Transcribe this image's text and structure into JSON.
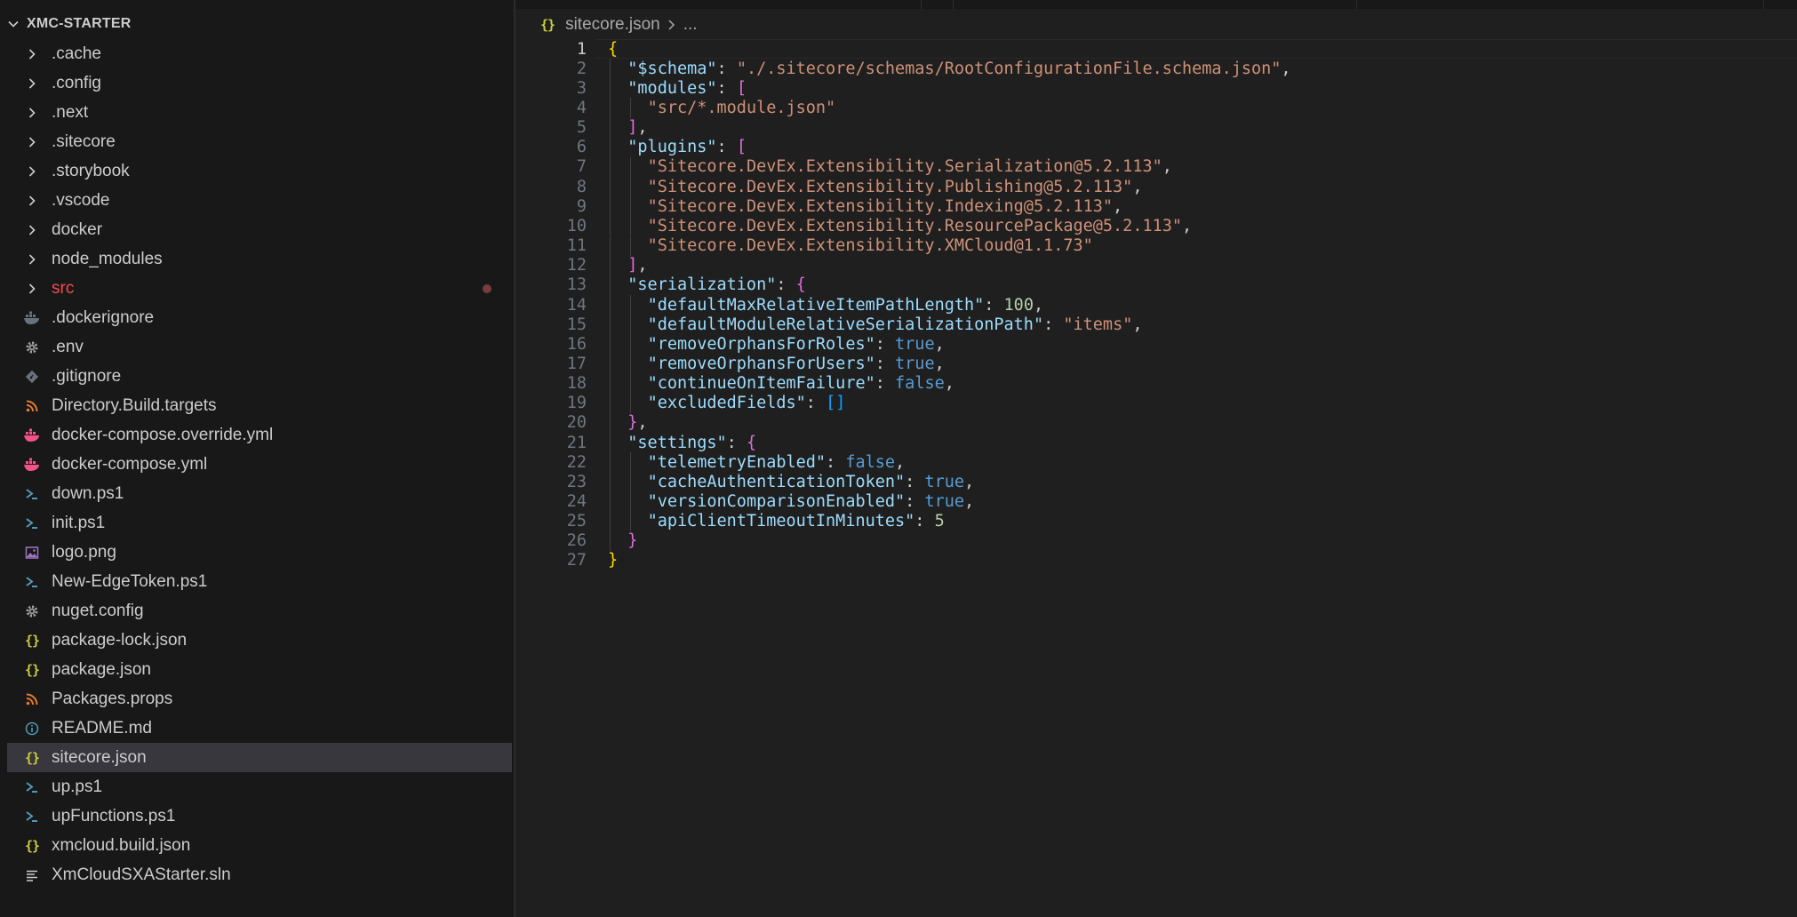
{
  "explorer": {
    "title": "XMC-STARTER",
    "items": [
      {
        "label": ".cache",
        "kind": "folder"
      },
      {
        "label": ".config",
        "kind": "folder"
      },
      {
        "label": ".next",
        "kind": "folder"
      },
      {
        "label": ".sitecore",
        "kind": "folder"
      },
      {
        "label": ".storybook",
        "kind": "folder"
      },
      {
        "label": ".vscode",
        "kind": "folder"
      },
      {
        "label": "docker",
        "kind": "folder"
      },
      {
        "label": "node_modules",
        "kind": "folder"
      },
      {
        "label": "src",
        "kind": "folder",
        "modified": true
      },
      {
        "label": ".dockerignore",
        "kind": "docker-ignore"
      },
      {
        "label": ".env",
        "kind": "gear"
      },
      {
        "label": ".gitignore",
        "kind": "git"
      },
      {
        "label": "Directory.Build.targets",
        "kind": "rss"
      },
      {
        "label": "docker-compose.override.yml",
        "kind": "docker"
      },
      {
        "label": "docker-compose.yml",
        "kind": "docker"
      },
      {
        "label": "down.ps1",
        "kind": "powershell"
      },
      {
        "label": "init.ps1",
        "kind": "powershell"
      },
      {
        "label": "logo.png",
        "kind": "image"
      },
      {
        "label": "New-EdgeToken.ps1",
        "kind": "powershell"
      },
      {
        "label": "nuget.config",
        "kind": "gear"
      },
      {
        "label": "package-lock.json",
        "kind": "json"
      },
      {
        "label": "package.json",
        "kind": "json"
      },
      {
        "label": "Packages.props",
        "kind": "rss"
      },
      {
        "label": "README.md",
        "kind": "info"
      },
      {
        "label": "sitecore.json",
        "kind": "json",
        "selected": true
      },
      {
        "label": "up.ps1",
        "kind": "powershell"
      },
      {
        "label": "upFunctions.ps1",
        "kind": "powershell"
      },
      {
        "label": "xmcloud.build.json",
        "kind": "json"
      },
      {
        "label": "XmCloudSXAStarter.sln",
        "kind": "lines"
      }
    ]
  },
  "breadcrumb": {
    "icon": "{}",
    "file": "sitecore.json",
    "rest": "..."
  },
  "editor": {
    "current_line": 1,
    "lines": [
      [
        [
          "b1",
          "{"
        ]
      ],
      [
        [
          "sp",
          "  "
        ],
        [
          "key",
          "\"$schema\""
        ],
        [
          "p",
          ": "
        ],
        [
          "str",
          "\"./.sitecore/schemas/RootConfigurationFile.schema.json\""
        ],
        [
          "p",
          ","
        ]
      ],
      [
        [
          "sp",
          "  "
        ],
        [
          "key",
          "\"modules\""
        ],
        [
          "p",
          ": "
        ],
        [
          "b2",
          "["
        ]
      ],
      [
        [
          "sp",
          "    "
        ],
        [
          "str",
          "\"src/*.module.json\""
        ]
      ],
      [
        [
          "sp",
          "  "
        ],
        [
          "b2",
          "]"
        ],
        [
          "p",
          ","
        ]
      ],
      [
        [
          "sp",
          "  "
        ],
        [
          "key",
          "\"plugins\""
        ],
        [
          "p",
          ": "
        ],
        [
          "b2",
          "["
        ]
      ],
      [
        [
          "sp",
          "    "
        ],
        [
          "str",
          "\"Sitecore.DevEx.Extensibility.Serialization@5.2.113\""
        ],
        [
          "p",
          ","
        ]
      ],
      [
        [
          "sp",
          "    "
        ],
        [
          "str",
          "\"Sitecore.DevEx.Extensibility.Publishing@5.2.113\""
        ],
        [
          "p",
          ","
        ]
      ],
      [
        [
          "sp",
          "    "
        ],
        [
          "str",
          "\"Sitecore.DevEx.Extensibility.Indexing@5.2.113\""
        ],
        [
          "p",
          ","
        ]
      ],
      [
        [
          "sp",
          "    "
        ],
        [
          "str",
          "\"Sitecore.DevEx.Extensibility.ResourcePackage@5.2.113\""
        ],
        [
          "p",
          ","
        ]
      ],
      [
        [
          "sp",
          "    "
        ],
        [
          "str",
          "\"Sitecore.DevEx.Extensibility.XMCloud@1.1.73\""
        ]
      ],
      [
        [
          "sp",
          "  "
        ],
        [
          "b2",
          "]"
        ],
        [
          "p",
          ","
        ]
      ],
      [
        [
          "sp",
          "  "
        ],
        [
          "key",
          "\"serialization\""
        ],
        [
          "p",
          ": "
        ],
        [
          "b2",
          "{"
        ]
      ],
      [
        [
          "sp",
          "    "
        ],
        [
          "key",
          "\"defaultMaxRelativeItemPathLength\""
        ],
        [
          "p",
          ": "
        ],
        [
          "num",
          "100"
        ],
        [
          "p",
          ","
        ]
      ],
      [
        [
          "sp",
          "    "
        ],
        [
          "key",
          "\"defaultModuleRelativeSerializationPath\""
        ],
        [
          "p",
          ": "
        ],
        [
          "str",
          "\"items\""
        ],
        [
          "p",
          ","
        ]
      ],
      [
        [
          "sp",
          "    "
        ],
        [
          "key",
          "\"removeOrphansForRoles\""
        ],
        [
          "p",
          ": "
        ],
        [
          "bool",
          "true"
        ],
        [
          "p",
          ","
        ]
      ],
      [
        [
          "sp",
          "    "
        ],
        [
          "key",
          "\"removeOrphansForUsers\""
        ],
        [
          "p",
          ": "
        ],
        [
          "bool",
          "true"
        ],
        [
          "p",
          ","
        ]
      ],
      [
        [
          "sp",
          "    "
        ],
        [
          "key",
          "\"continueOnItemFailure\""
        ],
        [
          "p",
          ": "
        ],
        [
          "bool",
          "false"
        ],
        [
          "p",
          ","
        ]
      ],
      [
        [
          "sp",
          "    "
        ],
        [
          "key",
          "\"excludedFields\""
        ],
        [
          "p",
          ": "
        ],
        [
          "b3",
          "[]"
        ]
      ],
      [
        [
          "sp",
          "  "
        ],
        [
          "b2",
          "}"
        ],
        [
          "p",
          ","
        ]
      ],
      [
        [
          "sp",
          "  "
        ],
        [
          "key",
          "\"settings\""
        ],
        [
          "p",
          ": "
        ],
        [
          "b2",
          "{"
        ]
      ],
      [
        [
          "sp",
          "    "
        ],
        [
          "key",
          "\"telemetryEnabled\""
        ],
        [
          "p",
          ": "
        ],
        [
          "bool",
          "false"
        ],
        [
          "p",
          ","
        ]
      ],
      [
        [
          "sp",
          "    "
        ],
        [
          "key",
          "\"cacheAuthenticationToken\""
        ],
        [
          "p",
          ": "
        ],
        [
          "bool",
          "true"
        ],
        [
          "p",
          ","
        ]
      ],
      [
        [
          "sp",
          "    "
        ],
        [
          "key",
          "\"versionComparisonEnabled\""
        ],
        [
          "p",
          ": "
        ],
        [
          "bool",
          "true"
        ],
        [
          "p",
          ","
        ]
      ],
      [
        [
          "sp",
          "    "
        ],
        [
          "key",
          "\"apiClientTimeoutInMinutes\""
        ],
        [
          "p",
          ": "
        ],
        [
          "num",
          "5"
        ]
      ],
      [
        [
          "sp",
          "  "
        ],
        [
          "b2",
          "}"
        ]
      ],
      [
        [
          "b1",
          "}"
        ]
      ]
    ]
  },
  "colors": {
    "background": "#1f1f1f",
    "sidebar": "#181818",
    "selection": "#37373d",
    "modified": "#f14c4c",
    "json_key": "#9cdcfe",
    "json_string": "#ce9178",
    "json_number": "#b5cea8",
    "json_boolean": "#569cd6"
  }
}
